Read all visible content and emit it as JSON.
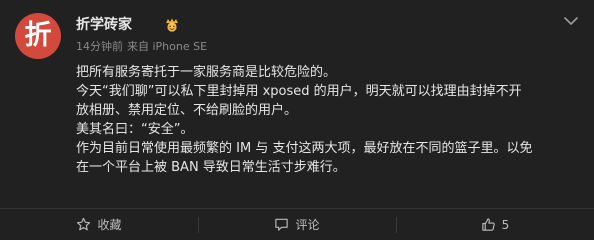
{
  "user": {
    "avatar_text": "折",
    "name": "折学砖家",
    "badge_icon": "vip-emoji-badge-icon"
  },
  "meta": {
    "time": "14分钟前",
    "source": "来自 iPhone SE"
  },
  "post": {
    "lines": [
      "把所有服务寄托于一家服务商是比较危险的。",
      "今天“我们聊”可以私下里封掉用 xposed 的用户，明天就可以找理由封掉不开",
      "放相册、禁用定位、不给刷脸的用户。",
      "美其名曰：“安全”。",
      "作为目前日常使用最频繁的 IM 与 支付这两大项，最好放在不同的篮子里。以免",
      "在一个平台上被 BAN 导致日常生活寸步难行。"
    ]
  },
  "actions": {
    "collect_label": "收藏",
    "comment_label": "评论",
    "like_count": "5"
  },
  "colors": {
    "background": "#212121",
    "avatar": "#d14a3c",
    "text": "#e6e6e6",
    "muted": "#8a8a8a"
  }
}
